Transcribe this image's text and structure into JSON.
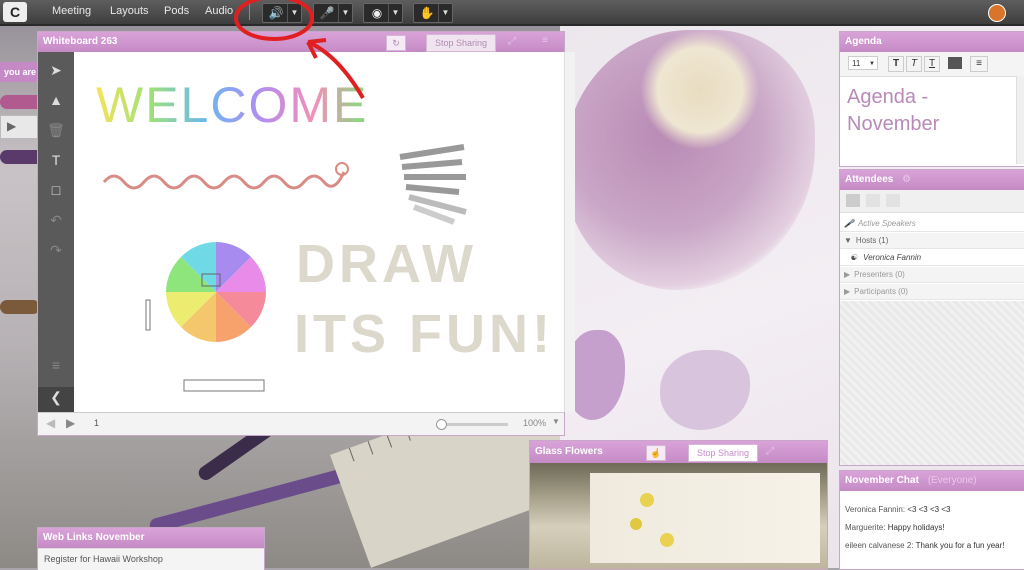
{
  "menu": {
    "logo": "C",
    "items": [
      "Meeting",
      "Layouts",
      "Pods",
      "Audio"
    ]
  },
  "toolbar": {
    "speaker_icon": "speaker-icon",
    "mic_icon": "microphone-icon",
    "camera_icon": "webcam-icon",
    "status_icon": "raise-hand-icon"
  },
  "side_tab": {
    "label": "you are"
  },
  "whiteboard": {
    "title": "Whiteboard 263",
    "stop_sharing": "Stop Sharing",
    "page_number": "1",
    "zoom": "100%",
    "drawing": {
      "welcome": "WELCOME",
      "draw": "DRAW",
      "fun": "ITS FUN!"
    }
  },
  "agenda": {
    "title": "Agenda",
    "font_size": "11",
    "content": "Agenda - November"
  },
  "attendees": {
    "title": "Attendees",
    "active_speakers": "Active Speakers",
    "hosts": "Hosts (1)",
    "host_name": "Veronica Fannin",
    "presenters": "Presenters (0)",
    "participants": "Participants (0)"
  },
  "glass_flowers": {
    "title": "Glass Flowers",
    "stop_sharing": "Stop Sharing"
  },
  "web_links": {
    "title": "Web Links November",
    "link": "Register for Hawaii Workshop"
  },
  "chat": {
    "title": "November Chat",
    "subtitle": "(Everyone)",
    "messages": [
      {
        "sender": "Veronica Fannin:",
        "text": "<3 <3 <3 <3"
      },
      {
        "sender": "Marguerite:",
        "text": "Happy holidays!"
      },
      {
        "sender": "eileen calvanese 2:",
        "text": "Thank you for a fun year!"
      }
    ]
  },
  "colors": {
    "pod_title": "#c58ac5",
    "annotation_red": "#e02020",
    "speaker_green": "#4fd21f"
  }
}
